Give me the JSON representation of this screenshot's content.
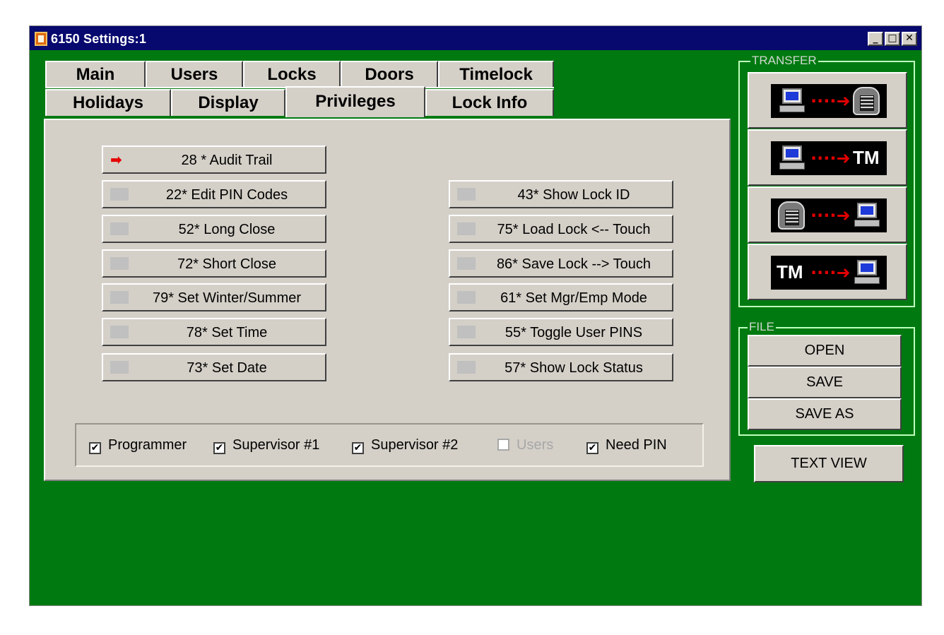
{
  "window": {
    "title": "6150 Settings:1",
    "controls": {
      "minimize": "_",
      "maximize": "□",
      "close": "✕"
    }
  },
  "tabs": {
    "row1": [
      "Main",
      "Users",
      "Locks",
      "Doors",
      "Timelock"
    ],
    "row2": [
      "Holidays",
      "Display",
      "Privileges",
      "Lock Info"
    ],
    "active": "Privileges"
  },
  "privileges": {
    "left": [
      {
        "label": "28 * Audit Trail",
        "indicator": "arrow"
      },
      {
        "label": "22* Edit PIN Codes",
        "indicator": "none"
      },
      {
        "label": "52*  Long Close",
        "indicator": "none"
      },
      {
        "label": "72*  Short Close",
        "indicator": "none"
      },
      {
        "label": "79* Set Winter/Summer",
        "indicator": "none"
      },
      {
        "label": "78* Set Time",
        "indicator": "none"
      },
      {
        "label": "73* Set Date",
        "indicator": "none"
      }
    ],
    "right": [
      {
        "label": "43* Show Lock ID",
        "indicator": "none"
      },
      {
        "label": "75* Load Lock <-- Touch",
        "indicator": "none"
      },
      {
        "label": "86* Save Lock --> Touch",
        "indicator": "none"
      },
      {
        "label": "61* Set Mgr/Emp Mode",
        "indicator": "none"
      },
      {
        "label": "55* Toggle User PINS",
        "indicator": "none"
      },
      {
        "label": "57* Show Lock Status",
        "indicator": "none"
      }
    ],
    "arrow_glyph": "➡"
  },
  "roles": [
    {
      "label": "Programmer",
      "checked": true,
      "enabled": true
    },
    {
      "label": "Supervisor #1",
      "checked": true,
      "enabled": true
    },
    {
      "label": "Supervisor #2",
      "checked": true,
      "enabled": true
    },
    {
      "label": "Users",
      "checked": false,
      "enabled": false
    },
    {
      "label": "Need PIN",
      "checked": true,
      "enabled": true
    }
  ],
  "transfer": {
    "label": "TRANSFER",
    "buttons": [
      {
        "name": "pc-to-lock",
        "from": "pc-icon",
        "to": "lock-icon"
      },
      {
        "name": "pc-to-tm",
        "from": "pc-icon",
        "to": "TM"
      },
      {
        "name": "lock-to-pc",
        "from": "lock-icon",
        "to": "pc-icon"
      },
      {
        "name": "tm-to-pc",
        "from": "TM",
        "to": "pc-icon"
      }
    ],
    "arrow": "····➜",
    "tm_text": "TM"
  },
  "file": {
    "label": "FILE",
    "open": "OPEN",
    "save": "SAVE",
    "save_as": "SAVE AS"
  },
  "text_view": "TEXT VIEW",
  "colors": {
    "background": "#007a10",
    "titlebar": "#07096e",
    "face": "#d4d0c8",
    "arrow": "#e50000"
  }
}
